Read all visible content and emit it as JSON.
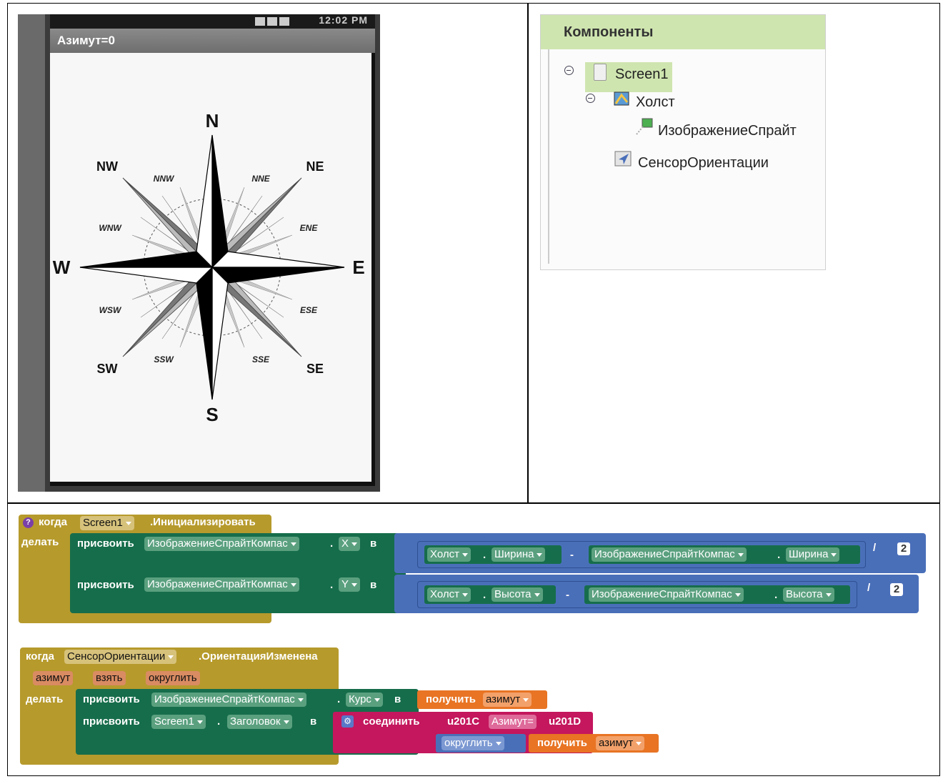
{
  "phone": {
    "status_clock": "12:02 PM",
    "app_title": "Азимут=0",
    "compass": {
      "north": "N",
      "south": "S",
      "east": "E",
      "west": "W",
      "nw": "NW",
      "ne": "NE",
      "sw": "SW",
      "se": "SE",
      "nnw": "NNW",
      "nne": "NNE",
      "wnw": "WNW",
      "ene": "ENE",
      "wsw": "WSW",
      "ese": "ESE",
      "ssw": "SSW",
      "sse": "SSE"
    }
  },
  "components": {
    "header": "Компоненты",
    "tree": [
      {
        "label": "Screen1",
        "icon": "screen-icon",
        "selected": true
      },
      {
        "label": "Холст",
        "icon": "canvas-icon"
      },
      {
        "label": "ИзображениеСпрайт",
        "icon": "sprite-icon"
      },
      {
        "label": "СенсорОриентации",
        "icon": "orientation-sensor-icon"
      }
    ]
  },
  "blocks": {
    "init": {
      "when": "когда",
      "component": "Screen1",
      "event": ".Инициализировать",
      "do": "делать",
      "set1": {
        "set": "присвоить",
        "component": "ИзображениеСпрайтКомпас",
        "dot": ".",
        "prop": "X",
        "to": "в",
        "a_comp": "Холст",
        "a_prop": "Ширина",
        "minus": "-",
        "b_comp": "ИзображениеСпрайтКомпас",
        "b_prop": "Ширина",
        "div": "/",
        "divisor": "2"
      },
      "set2": {
        "set": "присвоить",
        "component": "ИзображениеСпрайтКомпас",
        "dot": ".",
        "prop": "Y",
        "to": "в",
        "a_comp": "Холст",
        "a_prop": "Высота",
        "minus": "-",
        "b_comp": "ИзображениеСпрайтКомпас",
        "b_prop": "Высота",
        "div": "/",
        "divisor": "2"
      }
    },
    "orient": {
      "when": "когда",
      "component": "СенсорОриентации",
      "event": ".ОриентацияИзменена",
      "params": [
        "азимут",
        "взять",
        "округлить"
      ],
      "do": "делать",
      "set1": {
        "set": "присвоить",
        "component": "ИзображениеСпрайтКомпас",
        "dot": ".",
        "prop": "Курс",
        "to": "в",
        "get": "получить",
        "var": "азимут"
      },
      "set2": {
        "set": "присвоить",
        "component": "Screen1",
        "dot": ".",
        "prop": "Заголовок",
        "to": "в",
        "join": "соединить",
        "open": "u201C",
        "text": "Азимут=",
        "close": "u201D",
        "round": "округлить",
        "get": "получить",
        "var": "азимут"
      }
    }
  },
  "colors": {
    "event_block": "#b69a2c",
    "set_block": "#166d4b",
    "math_block": "#4a6fb9",
    "text_block": "#c4175d",
    "var_block": "#e87424",
    "component_panel_header": "#cfe5b0"
  }
}
